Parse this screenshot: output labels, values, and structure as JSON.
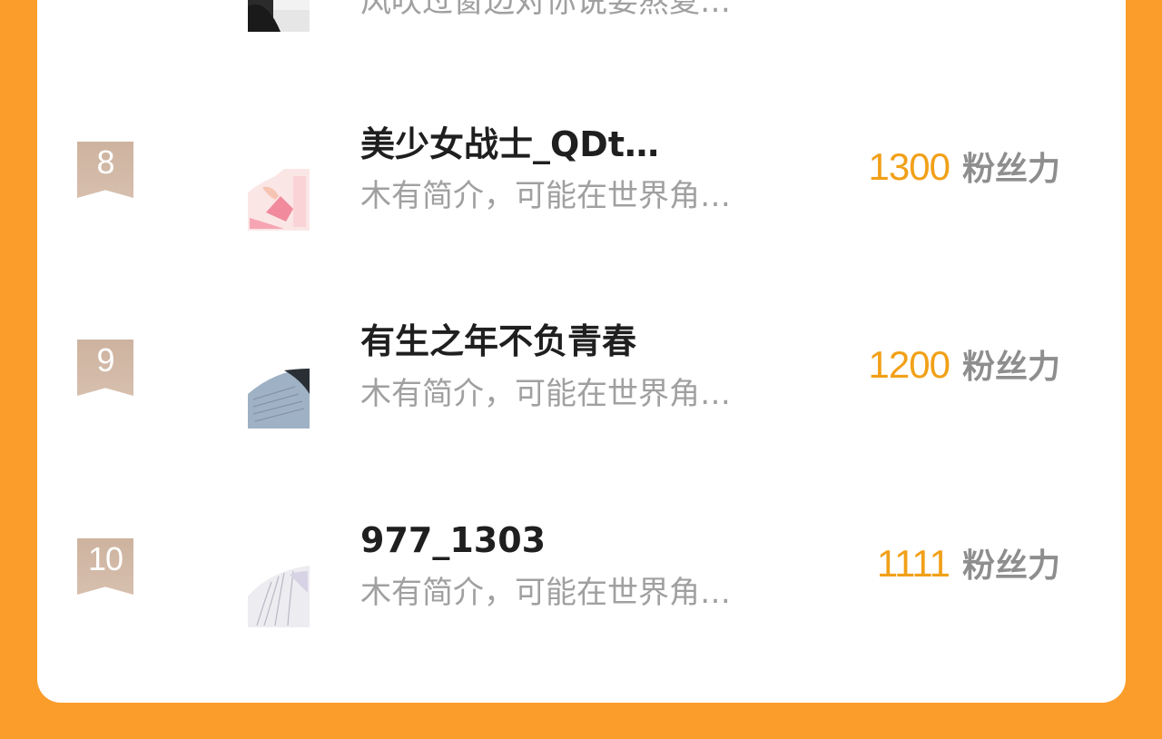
{
  "rows": [
    {
      "desc": "风吹过窗边对你说要熬夏…"
    },
    {
      "rank": "8",
      "name": "美少女战士_QDt…",
      "desc": "木有简介，可能在世界角…",
      "score": "1300",
      "unit": "粉丝力"
    },
    {
      "rank": "9",
      "name": "有生之年不负青春",
      "desc": "木有简介，可能在世界角…",
      "score": "1200",
      "unit": "粉丝力"
    },
    {
      "rank": "10",
      "name": "977_1303",
      "desc": "木有简介，可能在世界角…",
      "score": "1111",
      "unit": "粉丝力"
    }
  ]
}
